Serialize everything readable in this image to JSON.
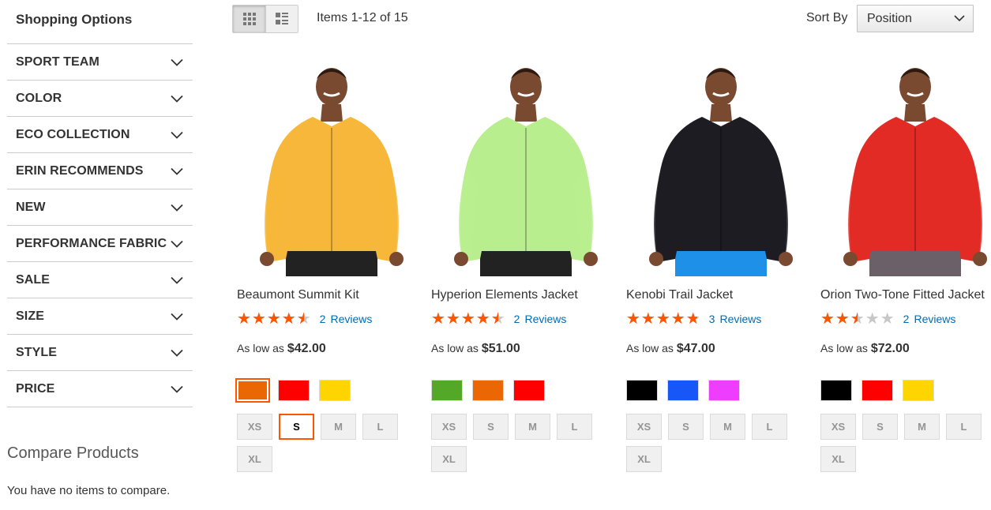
{
  "sidebar": {
    "title": "Shopping Options",
    "filters": [
      "SPORT TEAM",
      "COLOR",
      "ECO COLLECTION",
      "ERIN RECOMMENDS",
      "NEW",
      "PERFORMANCE FABRIC",
      "SALE",
      "SIZE",
      "STYLE",
      "PRICE"
    ],
    "compare_title": "Compare Products",
    "compare_empty": "You have no items to compare."
  },
  "toolbar": {
    "amount": "Items 1-12 of 15",
    "sort_label": "Sort By",
    "sort_value": "Position"
  },
  "products": [
    {
      "name": "Beaumont Summit Kit",
      "rating": 0.9,
      "review_count": "2",
      "review_word": "Reviews",
      "price_prefix": "As low as",
      "price": "$42.00",
      "swatch_colors": [
        "#eb6703",
        "#ff0000",
        "#ffd500"
      ],
      "sizes": [
        "XS",
        "S",
        "M",
        "L",
        "XL"
      ],
      "jacket_color": "#f7b73a",
      "pants_color": "#222222"
    },
    {
      "name": "Hyperion Elements Jacket",
      "rating": 0.9,
      "review_count": "2",
      "review_word": "Reviews",
      "price_prefix": "As low as",
      "price": "$51.00",
      "swatch_colors": [
        "#53a828",
        "#eb6703",
        "#ff0000"
      ],
      "sizes": [
        "XS",
        "S",
        "M",
        "L",
        "XL"
      ],
      "jacket_color": "#b8ee8e",
      "pants_color": "#222222"
    },
    {
      "name": "Kenobi Trail Jacket",
      "rating": 0.95,
      "review_count": "3",
      "review_word": "Reviews",
      "price_prefix": "As low as",
      "price": "$47.00",
      "swatch_colors": [
        "#000000",
        "#1857f7",
        "#ef3dff"
      ],
      "sizes": [
        "XS",
        "S",
        "M",
        "L",
        "XL"
      ],
      "jacket_color": "#1c1c22",
      "pants_color": "#1e90e8"
    },
    {
      "name": "Orion Two-Tone Fitted Jacket",
      "rating": 0.5,
      "review_count": "2",
      "review_word": "Reviews",
      "price_prefix": "As low as",
      "price": "$72.00",
      "swatch_colors": [
        "#000000",
        "#ff0000",
        "#ffd500"
      ],
      "sizes": [
        "XS",
        "S",
        "M",
        "L",
        "XL"
      ],
      "jacket_color": "#e32b26",
      "pants_color": "#6b6068"
    }
  ],
  "selected": {
    "product": 0,
    "swatch": 0,
    "size": "S"
  },
  "colors": {
    "accent": "#ff5501",
    "link": "#006bb4",
    "star_empty": "#c7c7c7"
  },
  "icons": {
    "grid": "grid-icon",
    "list": "list-icon",
    "chevron": "chevron-down-icon",
    "star": "star-icon"
  }
}
